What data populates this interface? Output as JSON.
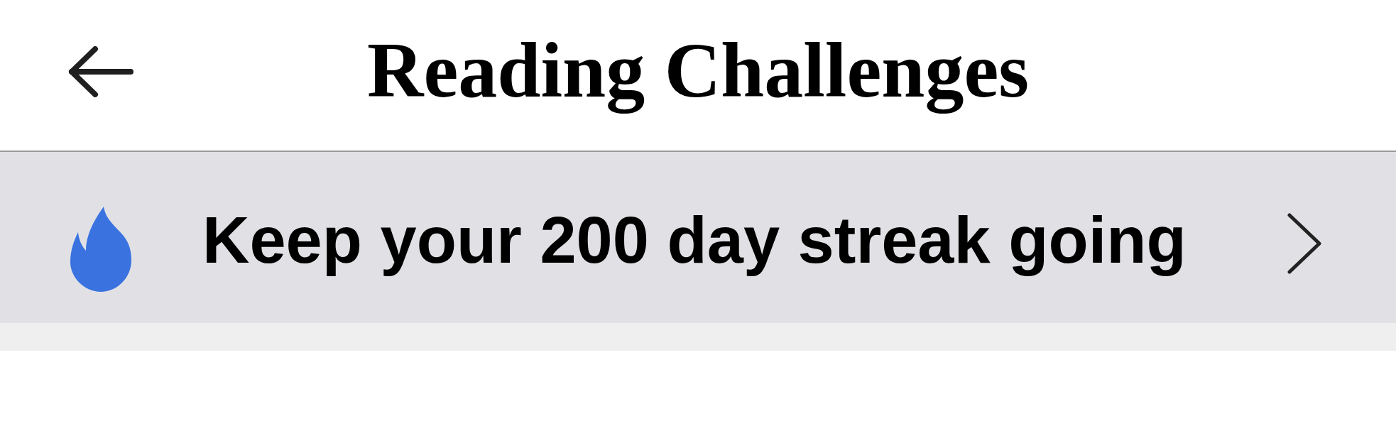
{
  "header": {
    "title": "Reading Challenges"
  },
  "streak_banner": {
    "text": "Keep your 200 day streak going"
  }
}
